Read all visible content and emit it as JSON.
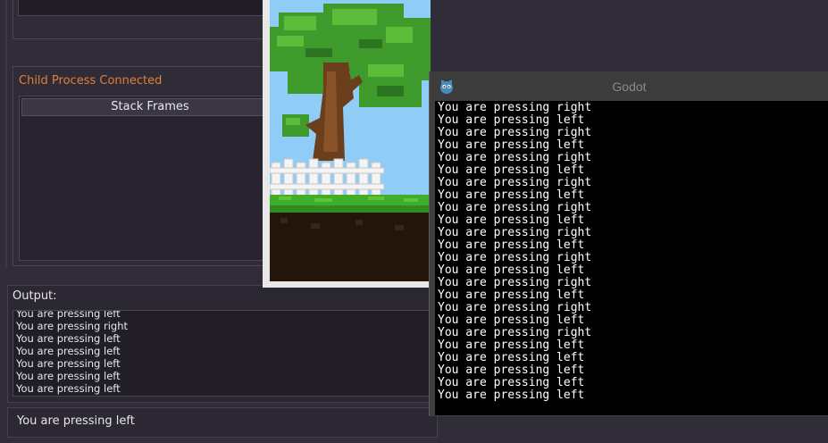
{
  "editor": {
    "child_process_status": "Child Process Connected",
    "stack_frames_header": "Stack Frames",
    "output_label": "Output:",
    "output_lines": [
      "You are pressing left",
      "You are pressing right",
      "You are pressing left",
      "You are pressing left",
      "You are pressing left",
      "You are pressing left",
      "You are pressing left"
    ],
    "status_text": "You are pressing left"
  },
  "console": {
    "title": "Godot",
    "lines": [
      "You are pressing right",
      "You are pressing left",
      "You are pressing right",
      "You are pressing left",
      "You are pressing right",
      "You are pressing left",
      "You are pressing right",
      "You are pressing left",
      "You are pressing right",
      "You are pressing left",
      "You are pressing right",
      "You are pressing left",
      "You are pressing right",
      "You are pressing left",
      "You are pressing right",
      "You are pressing left",
      "You are pressing right",
      "You are pressing left",
      "You are pressing right",
      "You are pressing left",
      "You are pressing left",
      "You are pressing left",
      "You are pressing left",
      "You are pressing left"
    ]
  },
  "colors": {
    "editor_bg": "#302c38",
    "accent_orange": "#e0803b",
    "sky": "#8fcdf6",
    "console_bg": "#000000"
  }
}
